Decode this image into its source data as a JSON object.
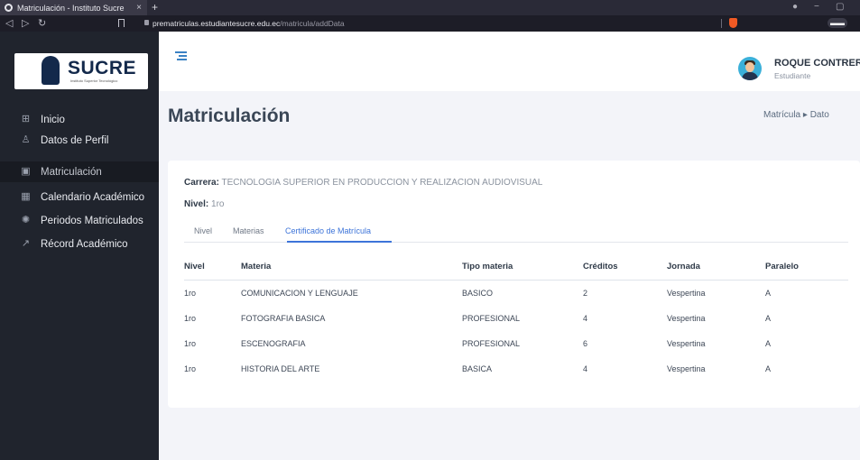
{
  "browser": {
    "tab_title": "Matriculación - Instituto Sucre",
    "tab_close": "×",
    "new_tab": "+",
    "url_host": "prematriculas.estudiantesucre.edu.ec",
    "url_path": "/matricula/addData"
  },
  "sidebar": {
    "logo_text": "SUCRE",
    "logo_sub": "Instituto Superior Tecnológico",
    "items": [
      {
        "label": "Inicio",
        "icon": "grid-icon"
      },
      {
        "label": "Datos de Perfil",
        "icon": "user-icon"
      },
      {
        "label": "Matriculación",
        "icon": "image-icon"
      },
      {
        "label": "Calendario Académico",
        "icon": "calendar-icon"
      },
      {
        "label": "Periodos Matriculados",
        "icon": "settings-icon"
      },
      {
        "label": "Récord Académico",
        "icon": "trend-icon"
      }
    ],
    "active_index": 2
  },
  "header": {
    "user_name": "ROQUE CONTRERAS",
    "user_role": "Estudiante"
  },
  "page": {
    "title": "Matriculación",
    "breadcrumb": "Matrícula ▸ Dato"
  },
  "card": {
    "carrera_label": "Carrera:",
    "carrera_value": " TECNOLOGIA SUPERIOR EN PRODUCCION Y REALIZACION AUDIOVISUAL",
    "nivel_label": "Nivel:",
    "nivel_value": " 1ro",
    "tabs": [
      "Nivel",
      "Materias",
      "Certificado de Matrícula"
    ],
    "active_tab": 2
  },
  "table": {
    "headers": [
      "Nivel",
      "Materia",
      "Tipo materia",
      "Créditos",
      "Jornada",
      "Paralelo"
    ],
    "rows": [
      [
        "1ro",
        "COMUNICACION Y LENGUAJE",
        "BASICO",
        "2",
        "Vespertina",
        "A"
      ],
      [
        "1ro",
        "FOTOGRAFIA BASICA",
        "PROFESIONAL",
        "4",
        "Vespertina",
        "A"
      ],
      [
        "1ro",
        "ESCENOGRAFIA",
        "PROFESIONAL",
        "6",
        "Vespertina",
        "A"
      ],
      [
        "1ro",
        "HISTORIA DEL ARTE",
        "BASICA",
        "4",
        "Vespertina",
        "A"
      ]
    ]
  }
}
